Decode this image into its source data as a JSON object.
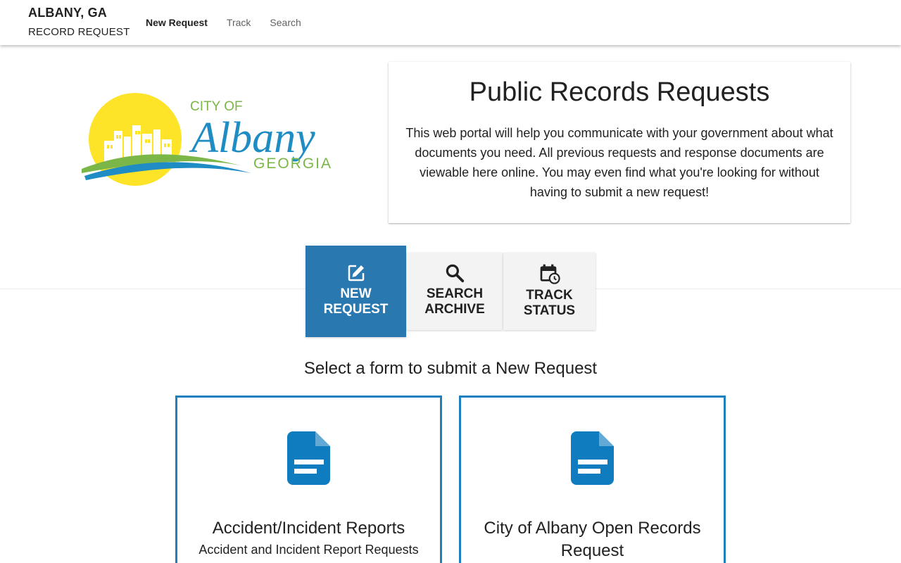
{
  "header": {
    "city": "ALBANY, GA",
    "subtitle": "RECORD REQUEST",
    "nav": [
      {
        "label": "New Request",
        "active": true
      },
      {
        "label": "Track",
        "active": false
      },
      {
        "label": "Search",
        "active": false
      }
    ]
  },
  "logo": {
    "line1": "CITY OF",
    "line2": "Albany",
    "line3": "GEORGIA",
    "colors": {
      "sun": "#fde428",
      "green": "#7ab648",
      "blue": "#1f8cc4"
    }
  },
  "intro": {
    "title": "Public Records Requests",
    "text": "This web portal will help you communicate with your government about what documents you need. All previous requests and response documents are viewable here online. You may even find what you're looking for without having to submit a new request!"
  },
  "actions": [
    {
      "line1": "NEW",
      "line2": "REQUEST",
      "icon": "edit-icon",
      "active": true
    },
    {
      "line1": "SEARCH",
      "line2": "ARCHIVE",
      "icon": "search-icon",
      "active": false
    },
    {
      "line1": "TRACK",
      "line2": "STATUS",
      "icon": "calendar-clock-icon",
      "active": false
    }
  ],
  "select_heading": "Select a form to submit a New Request",
  "forms": [
    {
      "title": "Accident/Incident Reports",
      "description": "Accident and Incident Report Requests",
      "icon": "document-icon"
    },
    {
      "title": "City of Albany Open Records Request",
      "description": "",
      "icon": "document-icon"
    }
  ],
  "colors": {
    "accent": "#2a78b0",
    "card_border": "#1f80c0",
    "tile_bg": "#f3f3f3"
  }
}
